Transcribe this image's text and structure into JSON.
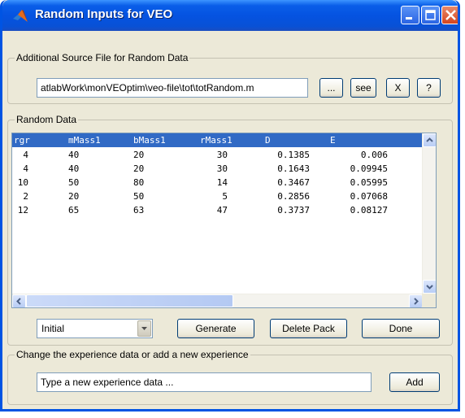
{
  "window": {
    "title": "Random Inputs for VEO"
  },
  "source_file": {
    "group_title": "Additional Source File for Random Data",
    "path_value": "atlabWork\\monVEOptim\\veo-file\\tot\\totRandom.m",
    "browse_label": "...",
    "see_label": "see",
    "clear_label": "X",
    "help_label": "?"
  },
  "random_data": {
    "group_title": "Random Data",
    "columns": [
      "rgr",
      "mMass1",
      "bMass1",
      "rMass1",
      "D",
      "E"
    ],
    "rows": [
      [
        "4",
        "40",
        "20",
        "30",
        "0.1385",
        "0.006"
      ],
      [
        "4",
        "40",
        "20",
        "30",
        "0.1643",
        "0.09945"
      ],
      [
        "10",
        "50",
        "80",
        "14",
        "0.3467",
        "0.05995"
      ],
      [
        "2",
        "20",
        "50",
        "5",
        "0.2856",
        "0.07068"
      ],
      [
        "12",
        "65",
        "63",
        "47",
        "0.3737",
        "0.08127"
      ]
    ],
    "mode_select_value": "Initial",
    "generate_label": "Generate",
    "delete_pack_label": "Delete Pack",
    "done_label": "Done"
  },
  "experience": {
    "group_title": "Change the experience data or add a new experience",
    "input_value": "Type a new experience data ...",
    "add_label": "Add"
  },
  "icons": {
    "app": "matlab-logo-icon",
    "minimize": "minimize-icon",
    "maximize": "maximize-icon",
    "close": "close-icon",
    "scroll_up": "scroll-up-arrow-icon",
    "scroll_down": "scroll-down-arrow-icon",
    "scroll_left": "scroll-left-arrow-icon",
    "scroll_right": "scroll-right-arrow-icon",
    "dropdown": "dropdown-arrow-icon"
  },
  "colors": {
    "titlebar": "#0553e1",
    "header_row": "#316ac5",
    "window_bg": "#ece9d8"
  }
}
